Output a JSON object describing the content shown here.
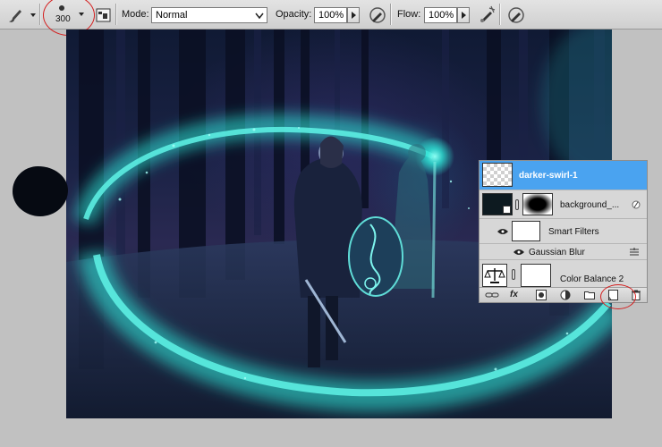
{
  "options_bar": {
    "tool_icon": "brush-icon",
    "brush_size": "300",
    "mode_label": "Mode:",
    "mode_value": "Normal",
    "opacity_label": "Opacity:",
    "opacity_value": "100%",
    "flow_label": "Flow:",
    "flow_value": "100%"
  },
  "layers_panel": {
    "layers": [
      {
        "name": "darker-swirl-1",
        "selected": true
      },
      {
        "name": "background_...",
        "selected": false
      },
      {
        "name": "Smart Filters",
        "selected": false
      },
      {
        "name": "Gaussian Blur",
        "selected": false
      },
      {
        "name": "Color Balance 2",
        "selected": false
      }
    ],
    "footer_fx": "fx"
  },
  "colors": {
    "selection": "#4aa3f0",
    "annotation": "#d42020",
    "swirl": "#2fe3d6"
  }
}
